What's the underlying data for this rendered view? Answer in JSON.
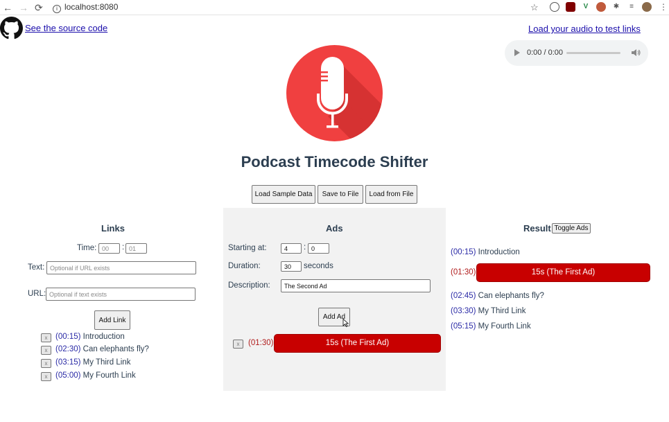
{
  "browser": {
    "url": "localhost:8080",
    "back": "←",
    "forward": "→",
    "reload": "⟳",
    "star": "☆"
  },
  "header": {
    "source_link": "See the source code",
    "audio_link": "Load your audio to test links",
    "audio_time": "0:00 / 0:00",
    "title": "Podcast Timecode Shifter"
  },
  "toolbar": {
    "load_sample": "Load Sample Data",
    "save_file": "Save to File",
    "load_file": "Load from File"
  },
  "links_panel": {
    "heading": "Links",
    "time_label": "Time:",
    "time_min_placeholder": "00",
    "time_sec_placeholder": "01",
    "time_sep": ":",
    "text_label": "Text:",
    "text_placeholder": "Optional if URL exists",
    "url_label": "URL:",
    "url_placeholder": "Optional if text exists",
    "add_button": "Add Link",
    "remove_glyph": "x",
    "items": [
      {
        "time": "(00:15)",
        "text": "Introduction"
      },
      {
        "time": "(02:30)",
        "text": "Can elephants fly?"
      },
      {
        "time": "(03:15)",
        "text": "My Third Link"
      },
      {
        "time": "(05:00)",
        "text": "My Fourth Link"
      }
    ]
  },
  "ads_panel": {
    "heading": "Ads",
    "starting_label": "Starting at:",
    "start_min": "4",
    "start_sec": "0",
    "time_sep": ":",
    "duration_label": "Duration:",
    "duration_value": "30",
    "duration_unit": "seconds",
    "description_label": "Description:",
    "description_value": "The Second Ad",
    "add_button": "Add Ad",
    "remove_glyph": "x",
    "items": [
      {
        "time": "(01:30)",
        "label": "15s (The First Ad)"
      }
    ]
  },
  "result_panel": {
    "heading": "Result",
    "toggle_button": "Toggle Ads",
    "items": [
      {
        "type": "link",
        "time": "(00:15)",
        "text": "Introduction"
      },
      {
        "type": "ad",
        "time": "(01:30)",
        "text": "15s (The First Ad)"
      },
      {
        "type": "link",
        "time": "(02:45)",
        "text": "Can elephants fly?"
      },
      {
        "type": "link",
        "time": "(03:30)",
        "text": "My Third Link"
      },
      {
        "type": "link",
        "time": "(05:15)",
        "text": "My Fourth Link"
      }
    ]
  },
  "colors": {
    "ad_red": "#c80000",
    "timecode_blue": "#2a2aa6",
    "ad_timecode": "#b01a1a",
    "logo_red": "#f04040",
    "panel_bg": "#f2f2f2",
    "heading_text": "#2c3e50"
  }
}
